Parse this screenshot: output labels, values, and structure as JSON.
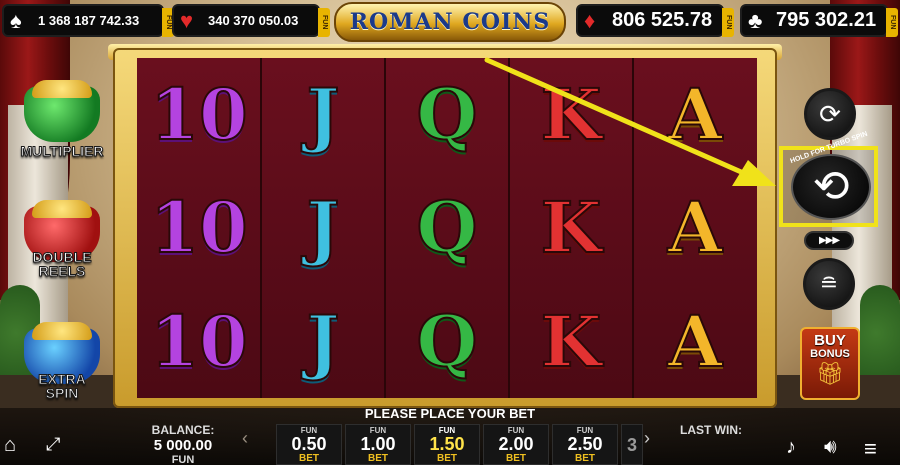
{
  "top": {
    "stats": [
      {
        "suit": "♠",
        "value": "1 368 187 742.33",
        "tag": "FUN",
        "suit_color": "#ffffff"
      },
      {
        "suit": "♥",
        "value": "340 370 050.03",
        "tag": "FUN",
        "suit_color": "#e22a2a"
      },
      {
        "suit": "♦",
        "value": "806 525.78",
        "tag": "FUN",
        "suit_color": "#e22a2a"
      },
      {
        "suit": "♣",
        "value": "795 302.21",
        "tag": "FUN",
        "suit_color": "#ffffff"
      }
    ],
    "logo": "ROMAN COINS"
  },
  "reels": {
    "columns": [
      [
        "10",
        "10",
        "10"
      ],
      [
        "J",
        "J",
        "J"
      ],
      [
        "Q",
        "Q",
        "Q"
      ],
      [
        "K",
        "K",
        "K"
      ],
      [
        "A",
        "A",
        "A"
      ]
    ]
  },
  "features": [
    {
      "label": "MULTIPLIER",
      "color": "green"
    },
    {
      "label": "DOUBLE REELS",
      "color": "red"
    },
    {
      "label": "EXTRA SPIN",
      "color": "blue"
    }
  ],
  "controls": {
    "autoplay_icon": "replay-icon",
    "spin_hint": "HOLD FOR TURBO SPIN",
    "spin_icon": "spin-arrows-icon",
    "turbo_label": "▶▶▶",
    "coins_icon": "coin-stack-icon",
    "buy_bonus_line1": "BUY",
    "buy_bonus_line2": "BONUS",
    "highlight_color": "#f0e21a"
  },
  "bottom": {
    "prompt": "PLEASE PLACE YOUR BET",
    "balance_label": "BALANCE:",
    "balance_value": "5 000.00",
    "balance_currency": "FUN",
    "last_win_label": "LAST WIN:",
    "bets": [
      {
        "top": "FUN",
        "amount": "0.50",
        "bottom": "BET",
        "selected": false
      },
      {
        "top": "FUN",
        "amount": "1.00",
        "bottom": "BET",
        "selected": false
      },
      {
        "top": "FUN",
        "amount": "1.50",
        "bottom": "BET",
        "selected": true
      },
      {
        "top": "FUN",
        "amount": "2.00",
        "bottom": "BET",
        "selected": false
      },
      {
        "top": "FUN",
        "amount": "2.50",
        "bottom": "BET",
        "selected": false
      }
    ],
    "partial_bet": "3",
    "icons": [
      "home-icon",
      "fullscreen-icon",
      "music-icon",
      "sound-icon",
      "menu-icon"
    ]
  }
}
